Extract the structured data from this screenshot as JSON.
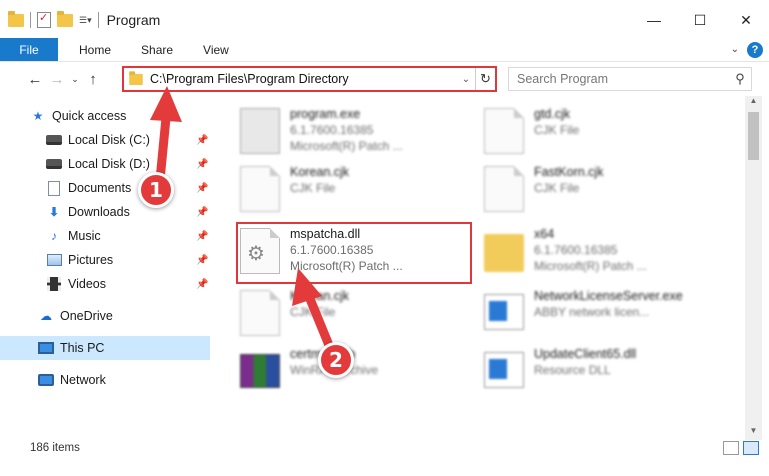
{
  "window": {
    "title": "Program",
    "controls": {
      "minimize": "—",
      "maximize": "☐",
      "close": "✕"
    }
  },
  "ribbon": {
    "tabs": [
      "File",
      "Home",
      "Share",
      "View"
    ]
  },
  "address": {
    "path": "C:\\Program Files\\Program Directory",
    "search_placeholder": "Search Program"
  },
  "sidebar": {
    "items": [
      {
        "label": "Quick access",
        "icon": "star-icon",
        "pinned": false
      },
      {
        "label": "Local Disk (C:)",
        "icon": "disk-icon",
        "pinned": true
      },
      {
        "label": "Local Disk (D:)",
        "icon": "disk-icon",
        "pinned": true
      },
      {
        "label": "Documents",
        "icon": "documents-icon",
        "pinned": true
      },
      {
        "label": "Downloads",
        "icon": "download-icon",
        "pinned": true
      },
      {
        "label": "Music",
        "icon": "music-icon",
        "pinned": true
      },
      {
        "label": "Pictures",
        "icon": "pictures-icon",
        "pinned": true
      },
      {
        "label": "Videos",
        "icon": "videos-icon",
        "pinned": true
      },
      {
        "label": "OneDrive",
        "icon": "cloud-icon",
        "pinned": false
      },
      {
        "label": "This PC",
        "icon": "pc-icon",
        "pinned": false,
        "selected": true
      },
      {
        "label": "Network",
        "icon": "network-icon",
        "pinned": false
      }
    ]
  },
  "files": {
    "left": [
      {
        "name": "program.exe",
        "line2": "6.1.7600.16385",
        "line3": "Microsoft(R) Patch ...",
        "icon": "exe-icon"
      },
      {
        "name": "Korean.cjk",
        "line2": "CJK File",
        "line3": "",
        "icon": "file-icon"
      },
      {
        "name": "mspatcha.dll",
        "line2": "6.1.7600.16385",
        "line3": "Microsoft(R) Patch ...",
        "icon": "gear-file-icon"
      },
      {
        "name": "Korean.cjk",
        "line2": "CJK File",
        "line3": "",
        "icon": "file-icon"
      },
      {
        "name": "certmgr.cab",
        "line2": "WinRAR archive",
        "line3": "",
        "icon": "rar-icon"
      }
    ],
    "right": [
      {
        "name": "gtd.cjk",
        "line2": "CJK File",
        "icon": "file-icon"
      },
      {
        "name": "FastKorn.cjk",
        "line2": "CJK File",
        "icon": "file-icon"
      },
      {
        "name": "x64",
        "line2": "6.1.7600.16385",
        "line3": "Microsoft(R) Patch ...",
        "icon": "folder-icon"
      },
      {
        "name": "NetworkLicenseServer.exe",
        "line2": "ABBY network licen...",
        "icon": "app-icon"
      },
      {
        "name": "UpdateClient65.dll",
        "line2": "Resource DLL",
        "icon": "app-icon"
      }
    ]
  },
  "status": {
    "count": "186 items"
  },
  "callouts": [
    "1",
    "2"
  ],
  "colors": {
    "accent": "#1979ca",
    "highlight": "#e0383a",
    "selected": "#cce8ff"
  }
}
